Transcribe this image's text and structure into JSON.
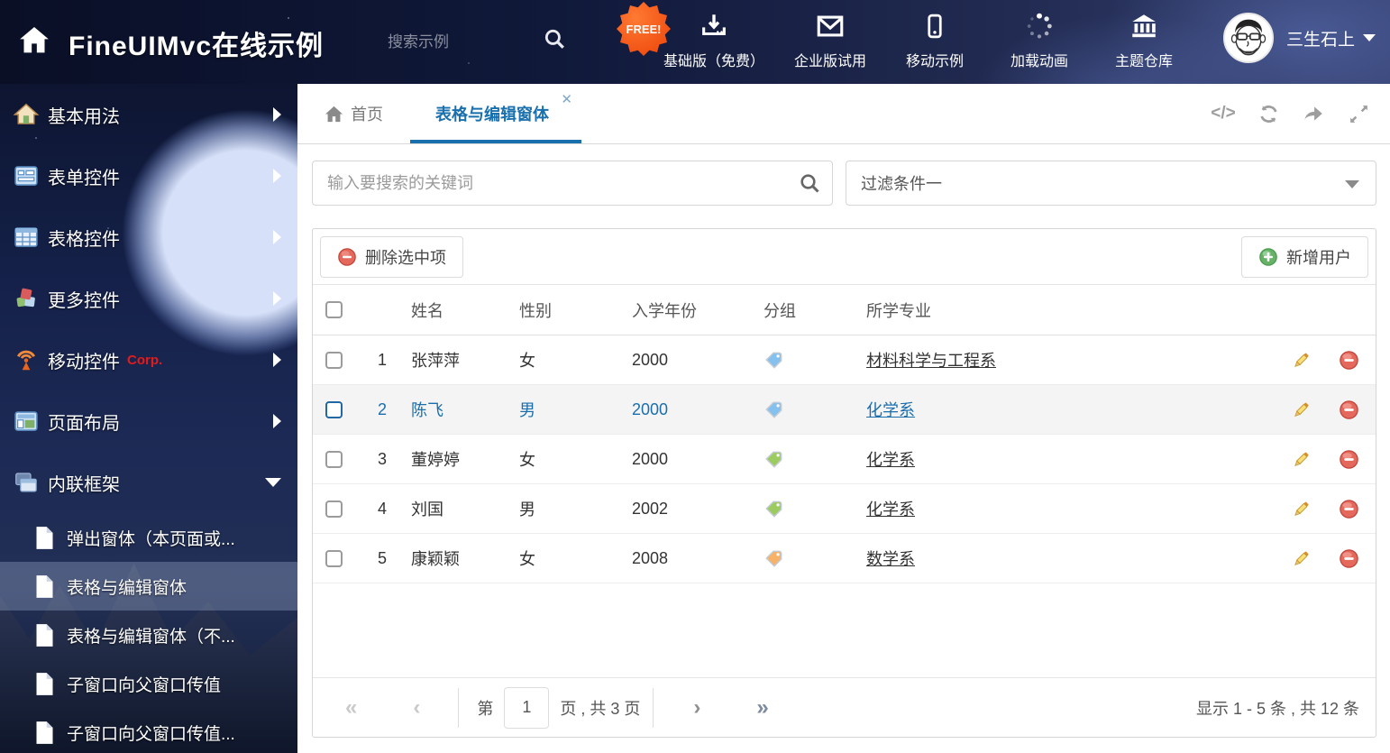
{
  "header": {
    "title": "FineUIMvc在线示例",
    "search_placeholder": "搜索示例",
    "free_badge": "FREE!",
    "nav": [
      {
        "icon": "download-icon",
        "label": "基础版（免费）"
      },
      {
        "icon": "envelope-icon",
        "label": "企业版试用"
      },
      {
        "icon": "mobile-icon",
        "label": "移动示例"
      },
      {
        "icon": "spinner-icon",
        "label": "加载动画"
      },
      {
        "icon": "bank-icon",
        "label": "主题仓库"
      }
    ],
    "user": {
      "name": "三生石上"
    }
  },
  "sidebar": {
    "items": [
      {
        "label": "基本用法",
        "icon": "home-icon"
      },
      {
        "label": "表单控件",
        "icon": "form-icon"
      },
      {
        "label": "表格控件",
        "icon": "table-icon"
      },
      {
        "label": "更多控件",
        "icon": "cubes-icon"
      },
      {
        "label": "移动控件",
        "icon": "antenna-icon",
        "badge": "Corp."
      },
      {
        "label": "页面布局",
        "icon": "layout-icon"
      },
      {
        "label": "内联框架",
        "icon": "frames-icon",
        "expanded": true
      }
    ],
    "subitems": [
      {
        "label": "弹出窗体（本页面或..."
      },
      {
        "label": "表格与编辑窗体",
        "selected": true
      },
      {
        "label": "表格与编辑窗体（不..."
      },
      {
        "label": "子窗口向父窗口传值"
      },
      {
        "label": "子窗口向父窗口传值..."
      }
    ]
  },
  "tabs": {
    "home": {
      "label": "首页",
      "icon": "home-icon"
    },
    "active": {
      "label": "表格与编辑窗体",
      "close": "x"
    },
    "tools": [
      "code-icon",
      "refresh-icon",
      "share-icon",
      "expand-icon"
    ]
  },
  "search": {
    "placeholder": "输入要搜索的关键词"
  },
  "filter": {
    "value": "过滤条件一"
  },
  "toolbar": {
    "delete_label": "删除选中项",
    "add_label": "新增用户"
  },
  "grid": {
    "columns": {
      "name": "姓名",
      "gender": "性别",
      "year": "入学年份",
      "group": "分组",
      "major": "所学专业"
    },
    "rows": [
      {
        "index": "1",
        "name": "张萍萍",
        "gender": "女",
        "year": "2000",
        "tag_color": "#85c1ee",
        "major": "材料科学与工程系"
      },
      {
        "index": "2",
        "name": "陈飞",
        "gender": "男",
        "year": "2000",
        "tag_color": "#85c1ee",
        "major": "化学系",
        "selected": true
      },
      {
        "index": "3",
        "name": "董婷婷",
        "gender": "女",
        "year": "2000",
        "tag_color": "#9ccc5f",
        "major": "化学系"
      },
      {
        "index": "4",
        "name": "刘国",
        "gender": "男",
        "year": "2002",
        "tag_color": "#9ccc5f",
        "major": "化学系"
      },
      {
        "index": "5",
        "name": "康颖颖",
        "gender": "女",
        "year": "2008",
        "tag_color": "#f7b267",
        "major": "数学系"
      }
    ]
  },
  "pagination": {
    "prefix": "第",
    "page_value": "1",
    "suffix": "页 , 共 3 页",
    "summary": "显示 1 - 5 条 , 共 12 条"
  },
  "colors": {
    "accent": "#1a6fad",
    "delete_red": "#d9534f",
    "add_green": "#5cb85c",
    "badge_orange": "#f04f12"
  }
}
